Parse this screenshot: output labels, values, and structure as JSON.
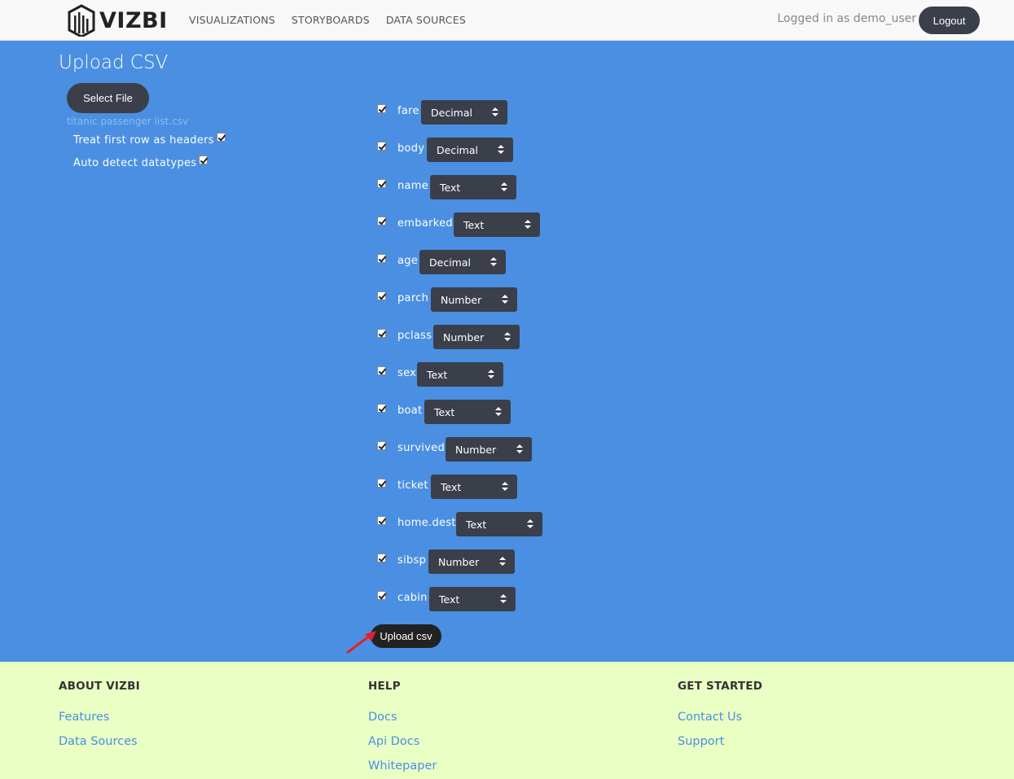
{
  "navbar": {
    "brand": "VIZBI",
    "links": [
      "VISUALIZATIONS",
      "STORYBOARDS",
      "DATA SOURCES"
    ],
    "logged_in_text": "Logged in as demo_user",
    "logout_label": "Logout"
  },
  "main": {
    "title": "Upload CSV",
    "select_file_label": "Select File",
    "file_name": "titanic passenger list.csv",
    "options": [
      {
        "label": "Treat first row as headers",
        "checked": true
      },
      {
        "label": "Auto detect datatypes",
        "checked": true
      }
    ],
    "columns": [
      {
        "name": "fare",
        "type": "Decimal",
        "checked": true
      },
      {
        "name": "body",
        "type": "Decimal",
        "checked": true
      },
      {
        "name": "name",
        "type": "Text",
        "checked": true
      },
      {
        "name": "embarked",
        "type": "Text",
        "checked": true
      },
      {
        "name": "age",
        "type": "Decimal",
        "checked": true
      },
      {
        "name": "parch",
        "type": "Number",
        "checked": true
      },
      {
        "name": "pclass",
        "type": "Number",
        "checked": true
      },
      {
        "name": "sex",
        "type": "Text",
        "checked": true
      },
      {
        "name": "boat",
        "type": "Text",
        "checked": true
      },
      {
        "name": "survived",
        "type": "Number",
        "checked": true
      },
      {
        "name": "ticket",
        "type": "Text",
        "checked": true
      },
      {
        "name": "home.dest",
        "type": "Text",
        "checked": true
      },
      {
        "name": "sibsp",
        "type": "Number",
        "checked": true
      },
      {
        "name": "cabin",
        "type": "Text",
        "checked": true
      }
    ],
    "upload_label": "Upload csv"
  },
  "footer": {
    "about": {
      "heading": "ABOUT VIZBI",
      "links": [
        "Features",
        "Data Sources"
      ]
    },
    "help": {
      "heading": "HELP",
      "links": [
        "Docs",
        "Api Docs",
        "Whitepaper"
      ]
    },
    "started": {
      "heading": "GET STARTED",
      "links": [
        "Contact Us",
        "Support"
      ]
    }
  },
  "colors": {
    "main_bg": "#4a8fe2",
    "footer_bg": "#eaffc4",
    "button_dark": "#3a3f4a",
    "link": "#4a8fe2"
  }
}
